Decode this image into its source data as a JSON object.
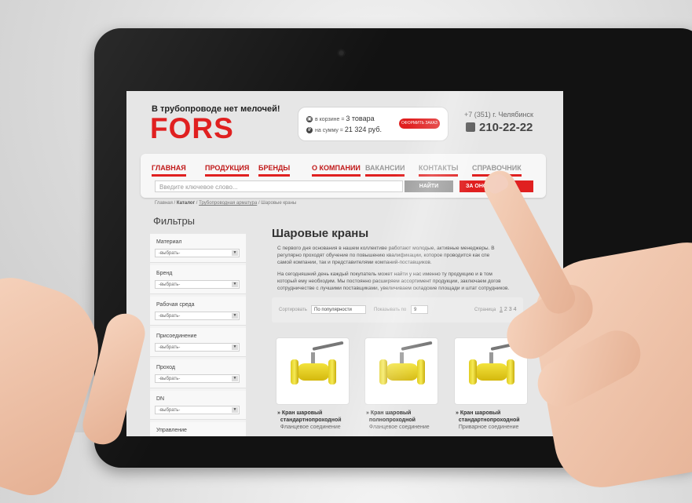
{
  "header": {
    "slogan": "В трубопроводе нет мелочей!",
    "logo": "FORS",
    "cart": {
      "items_label": "в корзине",
      "items_value": "3 товара",
      "sum_label": "на сумму",
      "sum_value": "21 324 руб.",
      "order_button": "ОФОРМИТЬ ЗАКАЗ"
    },
    "phone_top": "+7 (351)  г. Челябинск",
    "phone_number": "210-22-22"
  },
  "nav": {
    "items": [
      "ГЛАВНАЯ",
      "ПРОДУКЦИЯ",
      "БРЕНДЫ",
      "О КОМПАНИИ",
      "ВАКАНСИИ",
      "КОНТАКТЫ",
      "СПРАВОЧНИК"
    ]
  },
  "search": {
    "placeholder": "Введите ключевое слово...",
    "find_button": "НАЙТИ",
    "call_button": "ЗА          ОНОК"
  },
  "breadcrumb": {
    "home": "Главная /",
    "catalog": "Каталог",
    "section": "Трубопроводная арматура",
    "current": "/ Шаровые краны"
  },
  "filters": {
    "title": "Фильтры",
    "groups": [
      {
        "label": "Материал",
        "value": "-выбрать-"
      },
      {
        "label": "Бренд",
        "value": "-выбрать-"
      },
      {
        "label": "Рабочая среда",
        "value": "-выбрать-"
      },
      {
        "label": "Присоединение",
        "value": "-выбрать-"
      },
      {
        "label": "Проход",
        "value": "-выбрать-"
      },
      {
        "label": "DN",
        "value": "-выбрать-"
      },
      {
        "label": "Управление",
        "value": ""
      }
    ]
  },
  "content": {
    "title": "Шаровые краны",
    "para1_line1": "С первого дня основания в нашем коллективе работают молодые, активные менеджеры. В",
    "para1_line2": "регулярно проходят обучение по повышению квалификации, которое проводится как спе",
    "para1_line3": "самой компании, так и представителями компаний-поставщиков.",
    "para2_line1": "На сегодняшний день каждый покупатель может найти у нас именно ту продукцию и в том",
    "para2_line2": "который ему необходим. Мы постоянно расширяем ассортимент продукции, заключаем догов",
    "para2_line3": "сотрудничестве с лучшими поставщиками, увеличиваем складские площади и штат сотрудников."
  },
  "sortbar": {
    "sort_label": "Сортировать",
    "sort_value": "По популярности",
    "show_label": "Показывать по",
    "show_value": "9",
    "page_label": "Страница",
    "pages": [
      "1",
      "2",
      "3",
      "4"
    ]
  },
  "products": [
    {
      "name_line1": "Кран шаровый",
      "name_line2": "стандартнопроходной",
      "sub": "Фланцевое соединение"
    },
    {
      "name_line1": "Кран шаровый",
      "name_line2": "полнопроходной",
      "sub": "Фланцевое соединение"
    },
    {
      "name_line1": "Кран шаровый",
      "name_line2": "стандартнопроходной",
      "sub": "Приварное соединение"
    }
  ],
  "colors": {
    "accent": "#e02020",
    "text": "#333333",
    "muted": "#999999"
  }
}
